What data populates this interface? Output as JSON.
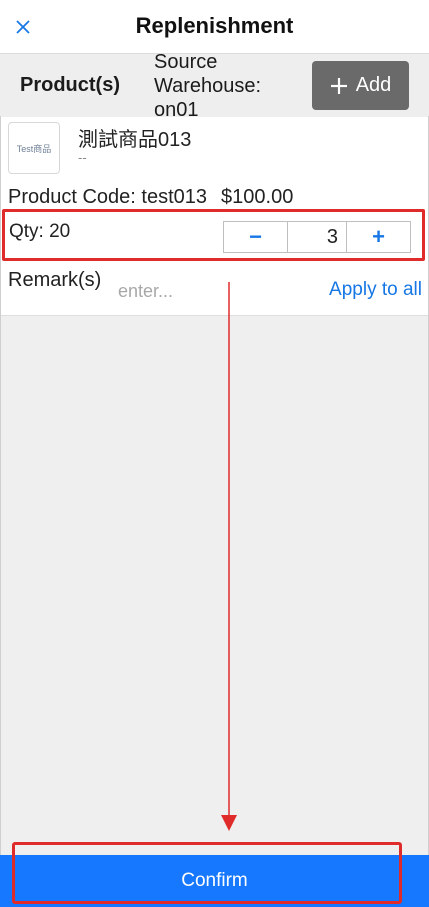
{
  "header": {
    "title": "Replenishment",
    "close_icon": "close-icon"
  },
  "subbar": {
    "products_label": "Product(s)",
    "warehouse_text": "Source Warehouse: on01",
    "add_label": "Add",
    "add_icon": "plus-icon"
  },
  "product": {
    "thumbnail_text": "Test商品",
    "name": "測試商品013",
    "subtitle": "--",
    "code_text": "Product Code: test013",
    "price": "$100.00",
    "qty_text": "Qty: 20",
    "stepper_value": "3",
    "minus_symbol": "−",
    "plus_symbol": "+",
    "remark_label": "Remark(s)",
    "remark_placeholder": "enter...",
    "remark_value": "",
    "apply_all_label": "Apply to all"
  },
  "footer": {
    "confirm_label": "Confirm"
  },
  "colors": {
    "accent": "#1677ff",
    "highlight": "#e02b2b",
    "add_button": "#6a6a6a"
  }
}
